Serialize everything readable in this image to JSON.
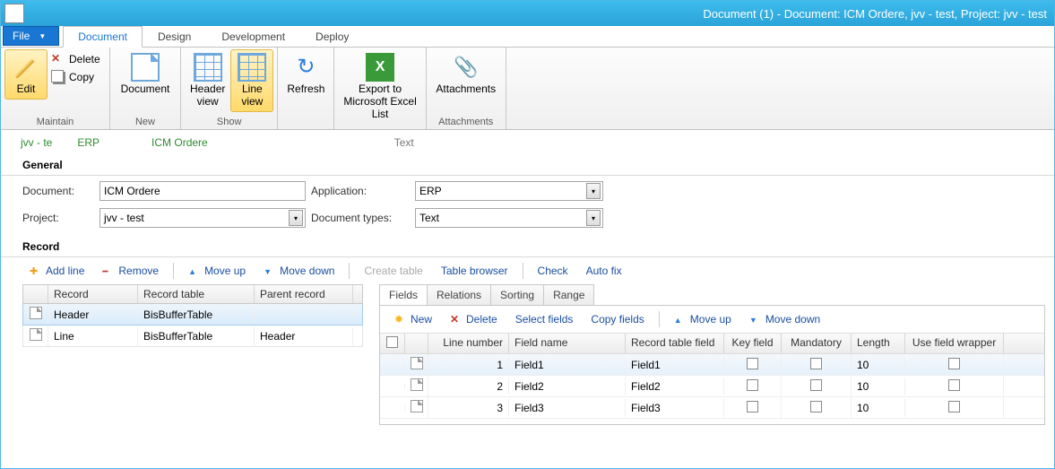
{
  "titlebar": {
    "title": "Document (1) - Document: ICM Ordere, jvv - test, Project: jvv - test"
  },
  "menu": {
    "file": "File",
    "tabs": [
      "Document",
      "Design",
      "Development",
      "Deploy"
    ],
    "active_index": 0
  },
  "ribbon": {
    "maintain": {
      "label": "Maintain",
      "edit": "Edit",
      "delete": "Delete",
      "copy": "Copy"
    },
    "new": {
      "label": "New",
      "document": "Document"
    },
    "show": {
      "label": "Show",
      "header_view": "Header\nview",
      "line_view": "Line\nview"
    },
    "refresh": "Refresh",
    "export": "Export to\nMicrosoft Excel\nList",
    "attachments": {
      "label": "Attachments",
      "btn": "Attachments"
    }
  },
  "breadcrumb": {
    "a": "jvv - te",
    "b": "ERP",
    "c": "ICM Ordere",
    "d": "Text"
  },
  "general": {
    "title": "General",
    "document_label": "Document:",
    "document_value": "ICM Ordere",
    "project_label": "Project:",
    "project_value": "jvv - test",
    "application_label": "Application:",
    "application_value": "ERP",
    "doctypes_label": "Document types:",
    "doctypes_value": "Text"
  },
  "record": {
    "title": "Record",
    "toolbar": {
      "add_line": "Add line",
      "remove": "Remove",
      "move_up": "Move up",
      "move_down": "Move down",
      "create_table": "Create table",
      "table_browser": "Table browser",
      "check": "Check",
      "auto_fix": "Auto fix"
    },
    "grid": {
      "cols": {
        "record": "Record",
        "record_table": "Record table",
        "parent": "Parent record"
      },
      "rows": [
        {
          "record": "Header",
          "table": "BisBufferTable",
          "parent": ""
        },
        {
          "record": "Line",
          "table": "BisBufferTable",
          "parent": "Header"
        }
      ],
      "selected_index": 0
    }
  },
  "right": {
    "tabs": [
      "Fields",
      "Relations",
      "Sorting",
      "Range"
    ],
    "active_index": 0,
    "toolbar": {
      "new": "New",
      "delete": "Delete",
      "select_fields": "Select fields",
      "copy_fields": "Copy fields",
      "move_up": "Move up",
      "move_down": "Move down"
    },
    "cols": {
      "line_number": "Line number",
      "field_name": "Field name",
      "record_table_field": "Record table field",
      "key_field": "Key field",
      "mandatory": "Mandatory",
      "length": "Length",
      "use_field_wrapper": "Use field wrapper"
    },
    "rows": [
      {
        "ln": "1",
        "fn": "Field1",
        "rtf": "Field1",
        "kf": false,
        "mand": false,
        "len": "10",
        "ufw": false
      },
      {
        "ln": "2",
        "fn": "Field2",
        "rtf": "Field2",
        "kf": false,
        "mand": false,
        "len": "10",
        "ufw": false
      },
      {
        "ln": "3",
        "fn": "Field3",
        "rtf": "Field3",
        "kf": false,
        "mand": false,
        "len": "10",
        "ufw": false
      }
    ]
  }
}
